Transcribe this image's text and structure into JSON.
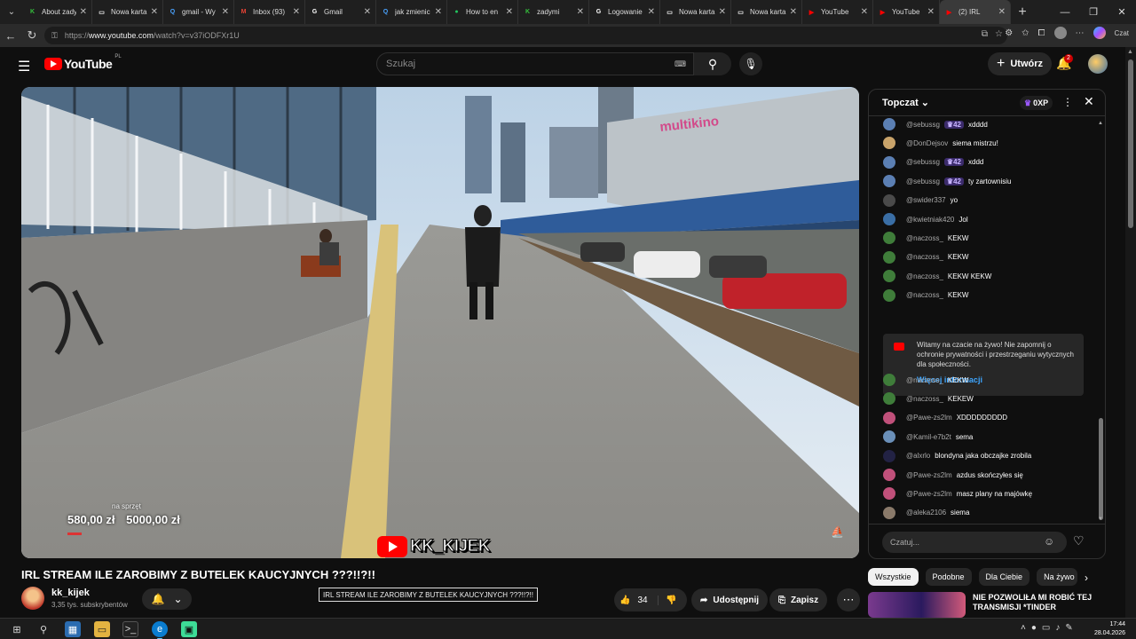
{
  "browser": {
    "tabs": [
      {
        "label": "About zadymy",
        "icon": "green-k-favicon",
        "color": "#35c13d",
        "glyph": "K"
      },
      {
        "label": "Nowa karta",
        "icon": "newtab-favicon",
        "color": "#ffffff",
        "glyph": "▭"
      },
      {
        "label": "gmail - Wy",
        "icon": "search-favicon",
        "color": "#4aa3ff",
        "glyph": "Q"
      },
      {
        "label": "Inbox (93)",
        "icon": "gmail-favicon",
        "color": "#ea4335",
        "glyph": "M"
      },
      {
        "label": "Gmail",
        "icon": "google-favicon",
        "color": "#ffffff",
        "glyph": "G"
      },
      {
        "label": "jak zmienic",
        "icon": "search-favicon",
        "color": "#4aa3ff",
        "glyph": "Q"
      },
      {
        "label": "How to en",
        "icon": "green-circle-favicon",
        "color": "#22c55e",
        "glyph": "●"
      },
      {
        "label": "zadymi",
        "icon": "green-k-favicon",
        "color": "#35c13d",
        "glyph": "K"
      },
      {
        "label": "Logowanie",
        "icon": "google-favicon",
        "color": "#ffffff",
        "glyph": "G"
      },
      {
        "label": "Nowa karta",
        "icon": "newtab-favicon",
        "color": "#ffffff",
        "glyph": "▭"
      },
      {
        "label": "Nowa karta",
        "icon": "newtab-favicon",
        "color": "#ffffff",
        "glyph": "▭"
      },
      {
        "label": "YouTube",
        "icon": "youtube-favicon",
        "color": "#ff0000",
        "glyph": "▶"
      },
      {
        "label": "YouTube",
        "icon": "youtube-favicon",
        "color": "#ff0000",
        "glyph": "▶"
      },
      {
        "label": "(2) IRL",
        "icon": "youtube-favicon",
        "color": "#ff0000",
        "glyph": "▶",
        "active": true
      }
    ],
    "url_prefix": "https://",
    "url_host": "www.youtube.com",
    "url_path": "/watch?v=v37iODFXr1U",
    "copilot_label": "Czat"
  },
  "youtube": {
    "logo_text": "YouTube",
    "region": "PL",
    "search_placeholder": "Szukaj",
    "create_label": "Utwórz",
    "notification_count": "2"
  },
  "video": {
    "title": "IRL STREAM ILE ZAROBIMY Z BUTELEK KAUCYJNYCH ???!!?!!",
    "donation_label": "na sprzęt",
    "donation_current": "580,00 zł",
    "donation_goal": "5000,00 zł",
    "donation_progress": 0.116,
    "watermark": "KK_KIJEK",
    "tooltip": "IRL STREAM ILE ZAROBIMY Z BUTELEK KAUCYJNYCH ???!!?!!",
    "channel_name": "kk_kijek",
    "channel_subs": "3,35 tys. subskrybentów",
    "likes": "34",
    "share_label": "Udostępnij",
    "save_label": "Zapisz"
  },
  "chat": {
    "mode_label": "Topczat",
    "xp_label": "0XP",
    "messages": [
      {
        "author": "@sebussg",
        "badge": "♛42",
        "text": "xdddd",
        "avatar": "#5b7fb3"
      },
      {
        "author": "@DonDejsov",
        "badge": "",
        "text": "siema mistrzu!",
        "avatar": "#c9a36a"
      },
      {
        "author": "@sebussg",
        "badge": "♛42",
        "text": "xddd",
        "avatar": "#5b7fb3"
      },
      {
        "author": "@sebussg",
        "badge": "♛42",
        "text": "ty zartownisiu",
        "avatar": "#5b7fb3"
      },
      {
        "author": "@swider337",
        "badge": "",
        "text": "yo",
        "avatar": "#4a4a4a"
      },
      {
        "author": "@kwietniak420",
        "badge": "",
        "text": "Jol",
        "avatar": "#3a6ea5"
      },
      {
        "author": "@naczoss_",
        "badge": "",
        "text": "KEKW",
        "avatar": "#3f7d3a"
      },
      {
        "author": "@naczoss_",
        "badge": "",
        "text": "KEKW",
        "avatar": "#3f7d3a"
      },
      {
        "author": "@naczoss_",
        "badge": "",
        "text": "KEKW KEKW",
        "avatar": "#3f7d3a"
      },
      {
        "author": "@naczoss_",
        "badge": "",
        "text": "KEKW",
        "avatar": "#3f7d3a"
      }
    ],
    "notice_text": "Witamy na czacie na żywo! Nie zapomnij o ochronie prywatności i przestrzeganiu wytycznych dla społeczności.",
    "notice_link": "Więcej informacji",
    "messages_after": [
      {
        "author": "@naczoss_",
        "badge": "",
        "text": "KEKW",
        "avatar": "#3f7d3a"
      },
      {
        "author": "@naczoss_",
        "badge": "",
        "text": "KEKEW",
        "avatar": "#3f7d3a"
      },
      {
        "author": "@Pawe-zs2lm",
        "badge": "",
        "text": "XDDDDDDDDD",
        "avatar": "#c0507a"
      },
      {
        "author": "@Kamil-e7b2t",
        "badge": "",
        "text": "sema",
        "avatar": "#6a8fb8"
      },
      {
        "author": "@alxrlo",
        "badge": "",
        "text": "blondyna jaka obczajke zrobila",
        "avatar": "#222244"
      },
      {
        "author": "@Pawe-zs2lm",
        "badge": "",
        "text": "azdus skończyłes się",
        "avatar": "#c0507a"
      },
      {
        "author": "@Pawe-zs2lm",
        "badge": "",
        "text": "masz plany na majówkę",
        "avatar": "#c0507a"
      },
      {
        "author": "@aleka2106",
        "badge": "",
        "text": "siema",
        "avatar": "#8a7a6a"
      }
    ],
    "input_placeholder": "Czatuj..."
  },
  "filters": [
    "Wszystkie",
    "Podobne",
    "Dla Ciebie",
    "Na żywo"
  ],
  "recommendation": {
    "title": "NIE POZWOLIŁA MI ROBIĆ TEJ TRANSMISJI *TINDER"
  },
  "taskbar": {
    "time": "17:44",
    "date": "28.04.2026"
  }
}
